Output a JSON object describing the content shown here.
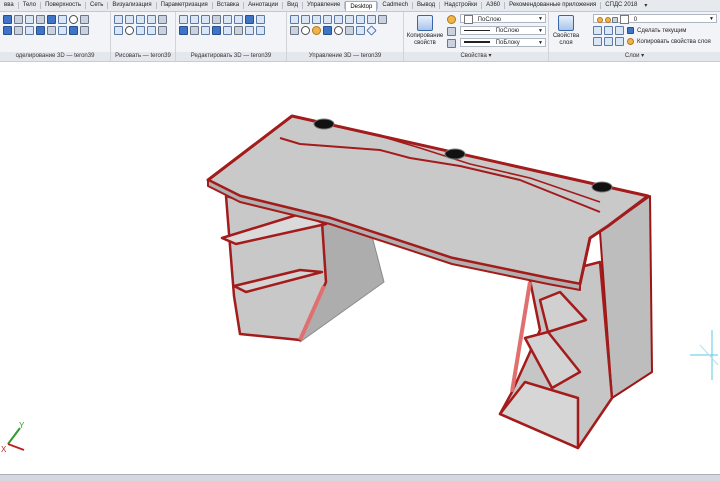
{
  "tabs": [
    {
      "label": "ввa",
      "active": false
    },
    {
      "label": "Тело",
      "active": false
    },
    {
      "label": "Поверхность",
      "active": false
    },
    {
      "label": "Сеть",
      "active": false
    },
    {
      "label": "Визуализация",
      "active": false
    },
    {
      "label": "Параметризация",
      "active": false
    },
    {
      "label": "Вставка",
      "active": false
    },
    {
      "label": "Аннотации",
      "active": false
    },
    {
      "label": "Вид",
      "active": false
    },
    {
      "label": "Управление",
      "active": false
    },
    {
      "label": "Desktop",
      "active": true
    },
    {
      "label": "Cadmech",
      "active": false
    },
    {
      "label": "Вывод",
      "active": false
    },
    {
      "label": "Надстройки",
      "active": false
    },
    {
      "label": "A360",
      "active": false
    },
    {
      "label": "Рекомендованные приложения",
      "active": false
    },
    {
      "label": "СПДС 2018",
      "active": false
    }
  ],
  "tab_more_icon": "dropdown-arrow",
  "ribbon": {
    "panels": {
      "modeling": "оделирование 3D — teron39",
      "draw": "Рисовать — teron39",
      "edit3d": "Редактировать 3D — teron39",
      "manage3d": "Управление 3D — teron39",
      "properties": "Свойства",
      "layers": "Слои"
    },
    "copy_properties": {
      "line1": "Копирование",
      "line2": "свойств"
    },
    "properties_rows": {
      "color": "ПоСлою",
      "linetype": "ПоСлою",
      "lineweight": "ПоБлоку"
    },
    "layer_properties": {
      "line1": "Свойства",
      "line2": "слоя"
    },
    "layer_combo": "0",
    "make_current": "Сделать текущим",
    "match_layer": "Копировать свойства слоя",
    "panel_expander": "▾"
  },
  "viewport": {
    "ucs_icon": {
      "x_label": "X",
      "y_label": "Y"
    },
    "accent_edge_color": "#a31b1b",
    "surface_color": "#c8c8c8"
  }
}
